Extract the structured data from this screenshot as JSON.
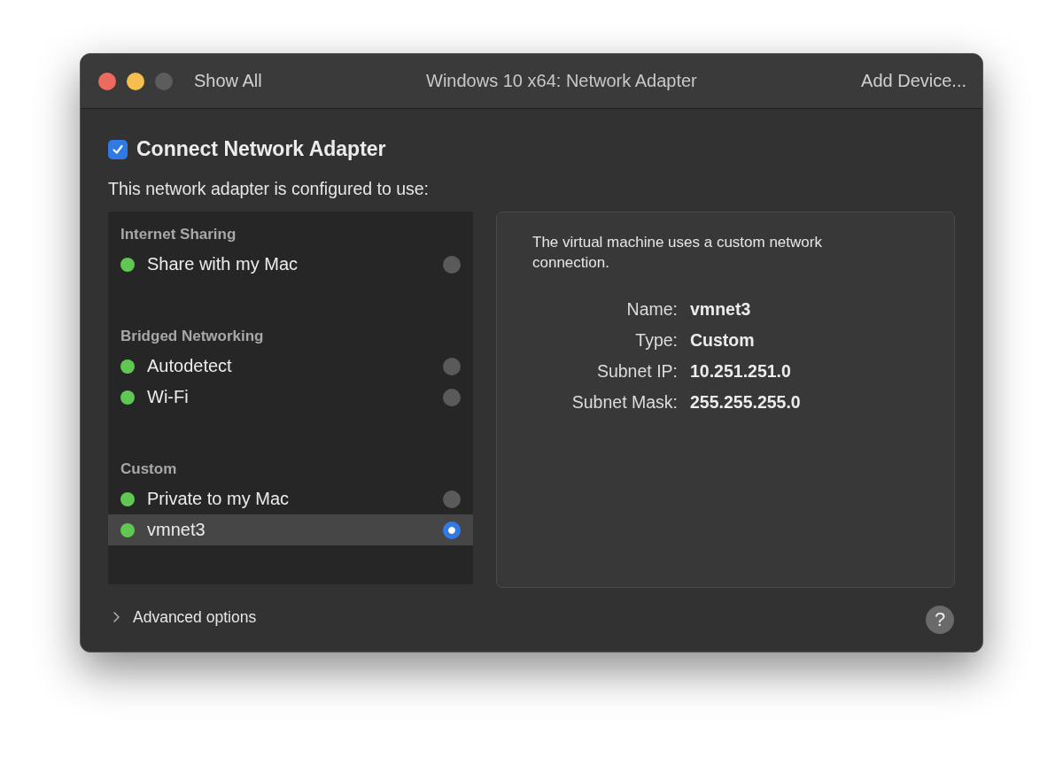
{
  "window": {
    "title": "Windows 10 x64: Network Adapter",
    "show_all": "Show All",
    "add_device": "Add Device..."
  },
  "connect": {
    "label": "Connect Network Adapter",
    "checked": true
  },
  "subtitle": "This network adapter is configured to use:",
  "groups": [
    {
      "title": "Internet Sharing",
      "items": [
        {
          "label": "Share with my Mac",
          "selected": false
        }
      ]
    },
    {
      "title": "Bridged Networking",
      "items": [
        {
          "label": "Autodetect",
          "selected": false
        },
        {
          "label": "Wi-Fi",
          "selected": false
        }
      ]
    },
    {
      "title": "Custom",
      "items": [
        {
          "label": "Private to my Mac",
          "selected": false
        },
        {
          "label": "vmnet3",
          "selected": true
        }
      ]
    }
  ],
  "details": {
    "description": "The virtual machine uses a custom network connection.",
    "fields": [
      {
        "label": "Name:",
        "value": "vmnet3"
      },
      {
        "label": "Type:",
        "value": "Custom"
      },
      {
        "label": "Subnet IP:",
        "value": "10.251.251.0"
      },
      {
        "label": "Subnet Mask:",
        "value": "255.255.255.0"
      }
    ]
  },
  "advanced": {
    "label": "Advanced options",
    "expanded": false
  },
  "help": "?"
}
